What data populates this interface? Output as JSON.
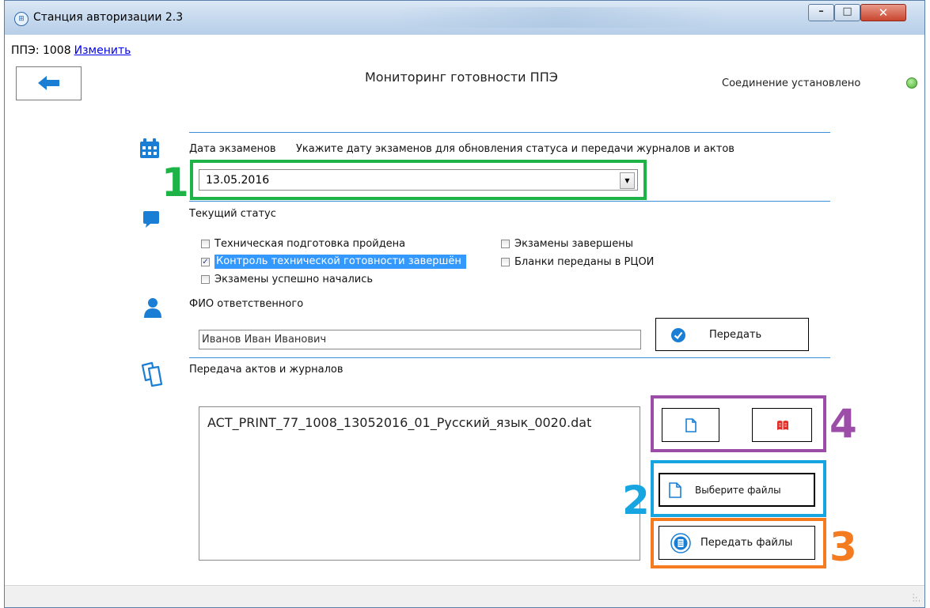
{
  "window": {
    "title": "Станция авторизации 2.3",
    "minimize_icon": "minimize-icon",
    "maximize_icon": "maximize-icon",
    "close_icon": "close-icon"
  },
  "ppe": {
    "label": "ППЭ: 1008",
    "change_link": "Изменить"
  },
  "header": {
    "back_icon": "arrow-left-icon",
    "title": "Мониторинг готовности ППЭ",
    "connection_status": "Соединение установлено",
    "connection_color": "#4caf2f"
  },
  "exam_date": {
    "label": "Дата экзаменов",
    "hint": "Укажите дату экзаменов для обновления статуса и передачи журналов и актов",
    "selected": "13.05.2016",
    "icon": "calendar-icon"
  },
  "status": {
    "label": "Текущий статус",
    "icon": "chat-bubble-icon",
    "items": [
      {
        "label": "Техническая подготовка пройдена",
        "checked": false
      },
      {
        "label": "Контроль технической готовности завершён",
        "checked": true
      },
      {
        "label": "Экзамены успешно начались",
        "checked": false
      },
      {
        "label": "Экзамены завершены",
        "checked": false
      },
      {
        "label": "Бланки переданы в РЦОИ",
        "checked": false
      }
    ]
  },
  "responsible": {
    "label": "ФИО ответственного",
    "icon": "person-icon",
    "value": "Иванов Иван Иванович",
    "send_button": "Передать"
  },
  "files": {
    "label": "Передача актов и журналов",
    "icon": "documents-icon",
    "list": [
      "ACT_PRINT_77_1008_13052016_01_Русский_язык_0020.dat"
    ],
    "choose_button": "Выберите файлы",
    "send_button": "Передать файлы"
  },
  "annotations": {
    "n1": "1",
    "n2": "2",
    "n3": "3",
    "n4": "4",
    "color1": "#1db347",
    "color2": "#16a5e0",
    "color3": "#f47b20",
    "color4": "#9b4da8"
  }
}
